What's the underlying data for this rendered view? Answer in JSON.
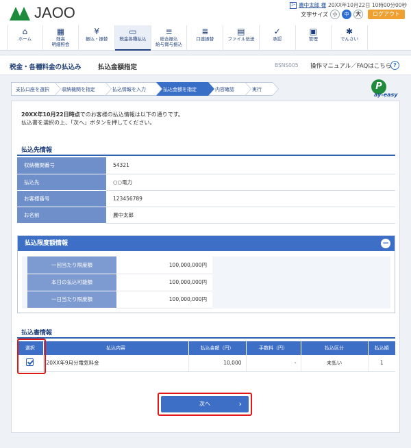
{
  "header": {
    "logo_text": "JA",
    "logo_text2": "OO",
    "user_icon": "ﾕｰ",
    "user_name": "農中太郎 様",
    "login_time": "20XX年10月22日 10時00分00秒",
    "font_size_label": "文字サイズ",
    "font_sizes": [
      "小",
      "中",
      "大"
    ],
    "logout_label": "ログアウト"
  },
  "nav": [
    {
      "label": "ホーム",
      "icon": "home-icon",
      "glyph": "⌂"
    },
    {
      "label": "残高\n明細照会",
      "icon": "bank-icon",
      "glyph": "▦"
    },
    {
      "label": "振込・振替",
      "icon": "yen-transfer-icon",
      "glyph": "¥"
    },
    {
      "label": "税金各種払込",
      "icon": "tax-payment-icon",
      "glyph": "▭"
    },
    {
      "label": "総合振込\n給与賞与振込",
      "icon": "coins-stack-icon",
      "glyph": "≡"
    },
    {
      "label": "口座振替",
      "icon": "account-transfer-icon",
      "glyph": "≣"
    },
    {
      "label": "ファイル伝送",
      "icon": "file-transfer-icon",
      "glyph": "▤"
    },
    {
      "label": "承認",
      "icon": "approval-icon",
      "glyph": "✓"
    },
    {
      "label": "管理",
      "icon": "admin-icon",
      "glyph": "▣"
    },
    {
      "label": "でんさい",
      "icon": "densai-icon",
      "glyph": "✱"
    }
  ],
  "title": {
    "category": "税金・各種料金の払込み",
    "page": "払込金額指定",
    "code": "BSNS005",
    "manual": "操作マニュアル／FAQはこちら",
    "help": "?"
  },
  "steps": [
    "支払口座を選択",
    "収納機関を指定",
    "払込情報を入力",
    "払込金額を指定",
    "内容確認",
    "実行"
  ],
  "payeasy": {
    "mark": "P",
    "text": "ay-easy"
  },
  "message": {
    "line1_bold": "20XX年10月22日時点",
    "line1_rest": "でのお客様の払込情報は以下の通りです。",
    "line2": "払込書を選択の上、「次へ」ボタンを押してください。"
  },
  "payee": {
    "title": "払込先情報",
    "rows": [
      {
        "k": "収納機関番号",
        "v": "54321"
      },
      {
        "k": "払込先",
        "v": "○○電力"
      },
      {
        "k": "お客様番号",
        "v": "123456789"
      },
      {
        "k": "お名前",
        "v": "農中太郎"
      }
    ]
  },
  "limit": {
    "title": "払込限度額情報",
    "toggle": "−",
    "rows": [
      {
        "k": "一回当たり限度額",
        "v": "100,000,000円"
      },
      {
        "k": "本日の払込可能額",
        "v": "100,000,000円"
      },
      {
        "k": "一日当たり限度額",
        "v": "100,000,000円"
      }
    ]
  },
  "bills": {
    "title": "払込書情報",
    "headers": [
      "選択",
      "払込内容",
      "払込金額（円）",
      "手数料（円）",
      "払込区分",
      "払込順"
    ],
    "rows": [
      {
        "content": "20XX年9月分電気料金",
        "amount": "10,000",
        "fee": "-",
        "status": "未払い",
        "order": "1"
      }
    ]
  },
  "next_button": {
    "label": "次へ",
    "arrow": "›"
  }
}
